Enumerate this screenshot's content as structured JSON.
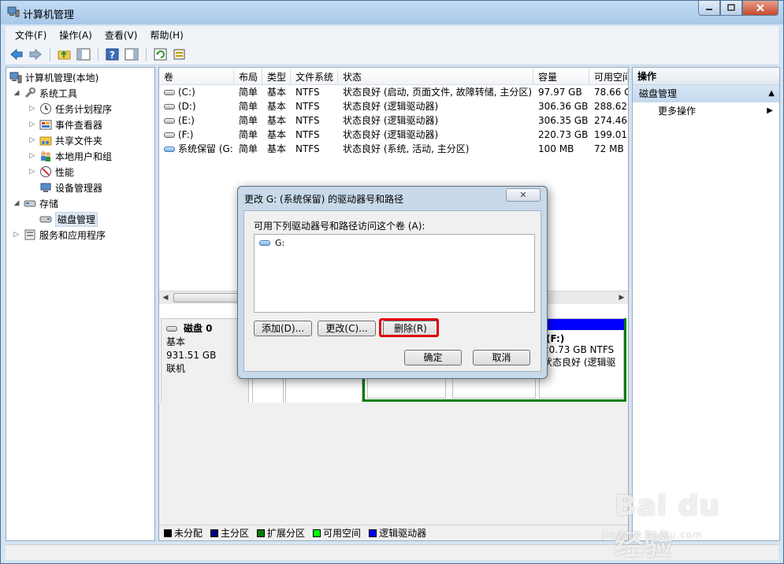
{
  "window": {
    "title": "计算机管理"
  },
  "menu": [
    "文件(F)",
    "操作(A)",
    "查看(V)",
    "帮助(H)"
  ],
  "tree": {
    "root": "计算机管理(本地)",
    "system_tools": "系统工具",
    "task_scheduler": "任务计划程序",
    "event_viewer": "事件查看器",
    "shared_folders": "共享文件夹",
    "local_users": "本地用户和组",
    "performance": "性能",
    "device_manager": "设备管理器",
    "storage": "存储",
    "disk_management": "磁盘管理",
    "services": "服务和应用程序"
  },
  "volumes": {
    "headers": [
      "卷",
      "布局",
      "类型",
      "文件系统",
      "状态",
      "容量",
      "可用空间"
    ],
    "rows": [
      {
        "name": "(C:)",
        "layout": "简单",
        "type": "基本",
        "fs": "NTFS",
        "status": "状态良好 (启动, 页面文件, 故障转储, 主分区)",
        "capacity": "97.97 GB",
        "free": "78.66 G"
      },
      {
        "name": "(D:)",
        "layout": "简单",
        "type": "基本",
        "fs": "NTFS",
        "status": "状态良好 (逻辑驱动器)",
        "capacity": "306.36 GB",
        "free": "288.62"
      },
      {
        "name": "(E:)",
        "layout": "简单",
        "type": "基本",
        "fs": "NTFS",
        "status": "状态良好 (逻辑驱动器)",
        "capacity": "306.35 GB",
        "free": "274.46"
      },
      {
        "name": "(F:)",
        "layout": "简单",
        "type": "基本",
        "fs": "NTFS",
        "status": "状态良好 (逻辑驱动器)",
        "capacity": "220.73 GB",
        "free": "199.01"
      },
      {
        "name": "系统保留 (G:)",
        "layout": "简单",
        "type": "基本",
        "fs": "NTFS",
        "status": "状态良好 (系统, 活动, 主分区)",
        "capacity": "100 MB",
        "free": "72 MB"
      }
    ]
  },
  "disk": {
    "name": "磁盘 0",
    "kind": "基本",
    "size": "931.51 GB",
    "state": "联机",
    "partition_f": {
      "label": "(F:)",
      "size": "20.73 GB NTFS",
      "status": "状态良好 (逻辑驱"
    }
  },
  "legend": [
    {
      "label": "未分配",
      "color": "#000000"
    },
    {
      "label": "主分区",
      "color": "#00007b"
    },
    {
      "label": "扩展分区",
      "color": "#007b00"
    },
    {
      "label": "可用空间",
      "color": "#00ff00"
    },
    {
      "label": "逻辑驱动器",
      "color": "#0000ff"
    }
  ],
  "actions": {
    "header": "操作",
    "section": "磁盘管理",
    "more": "更多操作"
  },
  "dialog": {
    "title": "更改 G: (系统保留) 的驱动器号和路径",
    "close": "✕",
    "prompt": "可用下列驱动器号和路径访问这个卷 (A):",
    "list_item": "G:",
    "add": "添加(D)...",
    "change": "更改(C)...",
    "delete": "删除(R)",
    "ok": "确定",
    "cancel": "取消"
  },
  "watermark": {
    "main": "Bai du 经验",
    "sub": "jingyan.baidu.com"
  },
  "colors": {
    "highlight": "#e0000b",
    "logical_drive": "#0000ff",
    "extended_partition": "#007b00"
  }
}
